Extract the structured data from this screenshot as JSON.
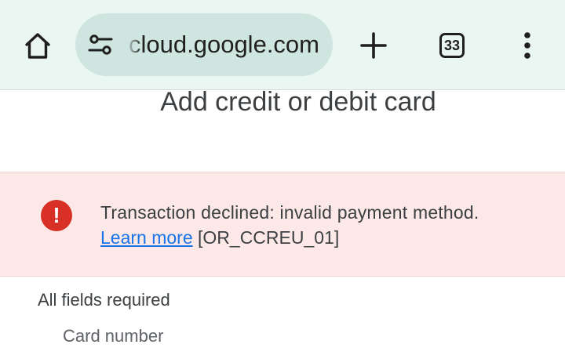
{
  "browser": {
    "url": "cloud.google.com",
    "tab_count": "33"
  },
  "page": {
    "title": "Add credit or debit card",
    "error": {
      "message": "Transaction declined: invalid payment method.",
      "link": "Learn more",
      "code": "[OR_CCREU_01]"
    },
    "fields_required": "All fields required",
    "card_number_label": "Card number"
  },
  "icons": {
    "home": "home-icon",
    "site_info": "tune-icon",
    "new_tab": "plus-icon",
    "tabs": "tab-switcher-icon",
    "menu": "more-vert-icon",
    "error": "error-icon"
  },
  "colors": {
    "toolbar_bg": "#eaf6f2",
    "omnibox_bg": "#cfe6e0",
    "error_bg": "#fce8e6",
    "error_red": "#d93025",
    "link_blue": "#1a73e8"
  }
}
